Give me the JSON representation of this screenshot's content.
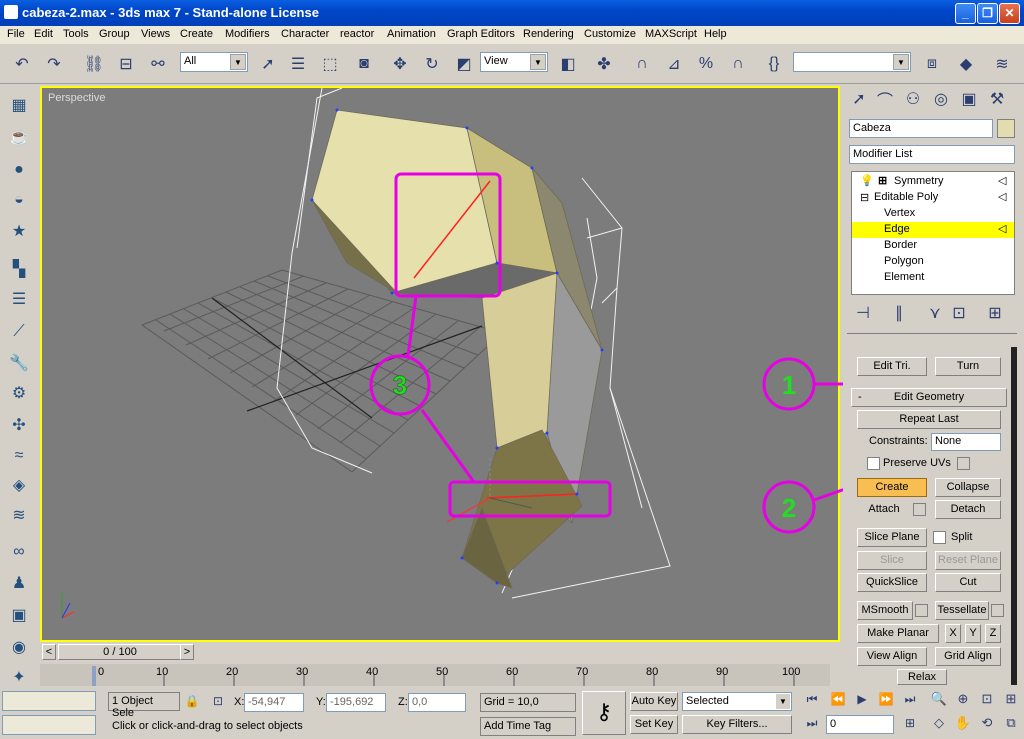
{
  "window": {
    "title": "cabeza-2.max - 3ds max 7 - Stand-alone License"
  },
  "menu": [
    "File",
    "Edit",
    "Tools",
    "Group",
    "Views",
    "Create",
    "Modifiers",
    "Character",
    "reactor",
    "Animation",
    "Graph Editors",
    "Rendering",
    "Customize",
    "MAXScript",
    "Help"
  ],
  "toolbar": {
    "selection_filter": "All",
    "ref_coord": "View",
    "named_selection": ""
  },
  "viewport": {
    "label": "Perspective"
  },
  "command_panel": {
    "object_name": "Cabeza",
    "modifier_list": "Modifier List",
    "stack": [
      "Symmetry",
      "Editable Poly",
      "Vertex",
      "Edge",
      "Border",
      "Polygon",
      "Element"
    ],
    "selected_subobject": "Edge",
    "edit_tri": "Edit Tri.",
    "turn": "Turn",
    "rollout_title": "Edit Geometry",
    "rollout_toggle": "-",
    "repeat_last": "Repeat Last",
    "constraints_label": "Constraints:",
    "constraints_value": "None",
    "preserve_uvs": "Preserve UVs",
    "create": "Create",
    "collapse": "Collapse",
    "attach": "Attach",
    "detach": "Detach",
    "slice_plane": "Slice Plane",
    "split": "Split",
    "slice": "Slice",
    "reset_plane": "Reset Plane",
    "quickslice": "QuickSlice",
    "cut": "Cut",
    "msmooth": "MSmooth",
    "tessellate": "Tessellate",
    "make_planar": "Make Planar",
    "x": "X",
    "y": "Y",
    "z": "Z",
    "view_align": "View Align",
    "grid_align": "Grid Align",
    "relax": "Relax"
  },
  "annotations": [
    "1",
    "2",
    "3"
  ],
  "timeline": {
    "frame": "0 / 100",
    "prev": "<",
    "next": ">"
  },
  "ruler_ticks": [
    "0",
    "10",
    "20",
    "30",
    "40",
    "50",
    "60",
    "70",
    "80",
    "90",
    "100"
  ],
  "status": {
    "selection": "1 Object Sele",
    "x_label": "X:",
    "x_value": "-54,947",
    "y_label": "Y:",
    "y_value": "-195,692",
    "z_label": "Z:",
    "z_value": "0,0",
    "grid": "Grid = 10,0",
    "prompt": "Click or click-and-drag to select objects",
    "add_time_tag": "Add Time Tag",
    "auto_key": "Auto Key",
    "set_key": "Set Key",
    "key_mode": "Selected",
    "key_filters": "Key Filters...",
    "current_frame": "0"
  },
  "colors": {
    "viewport_bg": "#7c7c7c",
    "viewport_border": "#ffff00",
    "annotation": "#e600e6",
    "annotation_text": "#22dd22",
    "selected_edge": "#ff2020",
    "mesh_light": "#e6e0ac",
    "mesh_dark": "#76704a"
  }
}
